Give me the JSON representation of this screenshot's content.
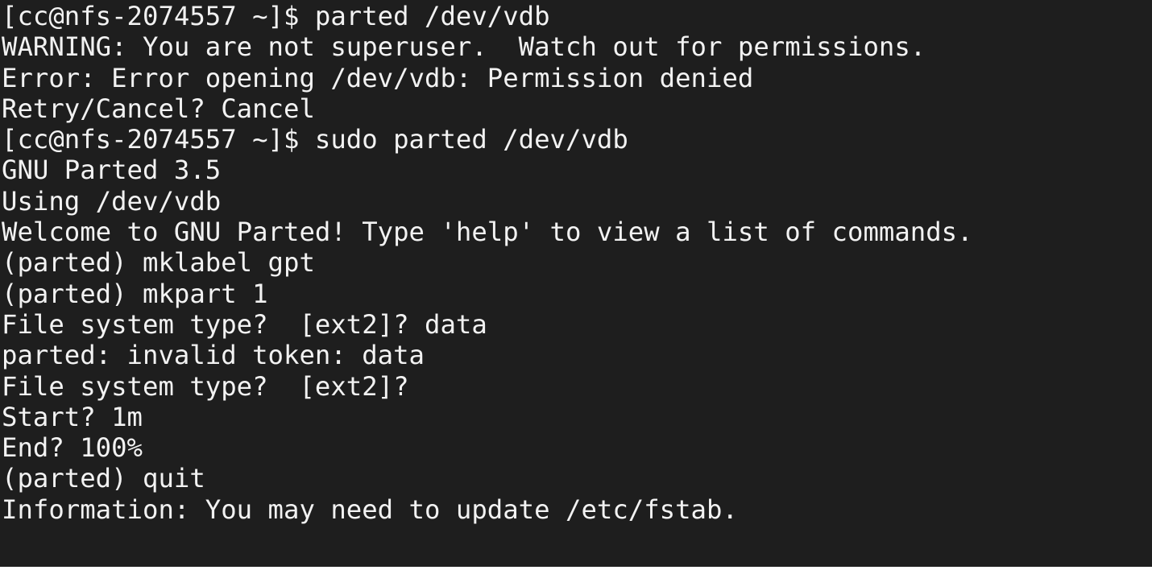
{
  "terminal": {
    "lines": [
      "[cc@nfs-2074557 ~]$ parted /dev/vdb",
      "WARNING: You are not superuser.  Watch out for permissions.",
      "Error: Error opening /dev/vdb: Permission denied",
      "Retry/Cancel? Cancel",
      "[cc@nfs-2074557 ~]$ sudo parted /dev/vdb",
      "GNU Parted 3.5",
      "Using /dev/vdb",
      "Welcome to GNU Parted! Type 'help' to view a list of commands.",
      "(parted) mklabel gpt",
      "(parted) mkpart 1",
      "File system type?  [ext2]? data",
      "parted: invalid token: data",
      "File system type?  [ext2]?",
      "Start? 1m",
      "End? 100%",
      "(parted) quit",
      "Information: You may need to update /etc/fstab."
    ]
  }
}
